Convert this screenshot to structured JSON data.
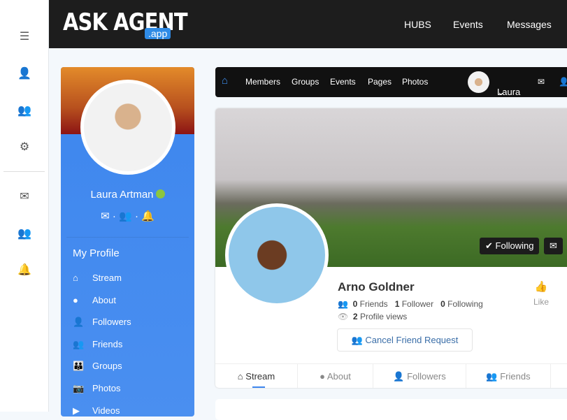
{
  "brand": {
    "name": "ASK AGENT",
    "suffix": ".app",
    "accent": "#2f8be6"
  },
  "topnav": [
    "HUBS",
    "Events",
    "Messages"
  ],
  "rail_icons": [
    "menu-icon",
    "user-icon",
    "users-icon",
    "gear-icon",
    "envelope-icon",
    "users-icon",
    "bell-icon"
  ],
  "sidebar": {
    "user_name": "Laura Artman",
    "section": "My Profile",
    "items": [
      {
        "label": "Stream",
        "icon": "⌂"
      },
      {
        "label": "About",
        "icon": "●"
      },
      {
        "label": "Followers",
        "icon": "👤"
      },
      {
        "label": "Friends",
        "icon": "👥"
      },
      {
        "label": "Groups",
        "icon": "👪"
      },
      {
        "label": "Photos",
        "icon": "📷"
      },
      {
        "label": "Videos",
        "icon": "▶"
      }
    ]
  },
  "subnav": {
    "items": [
      "Members",
      "Groups",
      "Events",
      "Pages",
      "Photos"
    ],
    "user": "Laura"
  },
  "profile": {
    "name": "Arno Goldner",
    "friends": "0",
    "friends_label": "Friends",
    "followers": "1",
    "followers_label": "Follower",
    "following": "0",
    "following_label": "Following",
    "views": "2",
    "views_label": "Profile views",
    "following_button": "Following",
    "cancel_request": "Cancel Friend Request",
    "like": "Like",
    "tabs": [
      "Stream",
      "About",
      "Followers",
      "Friends"
    ]
  }
}
